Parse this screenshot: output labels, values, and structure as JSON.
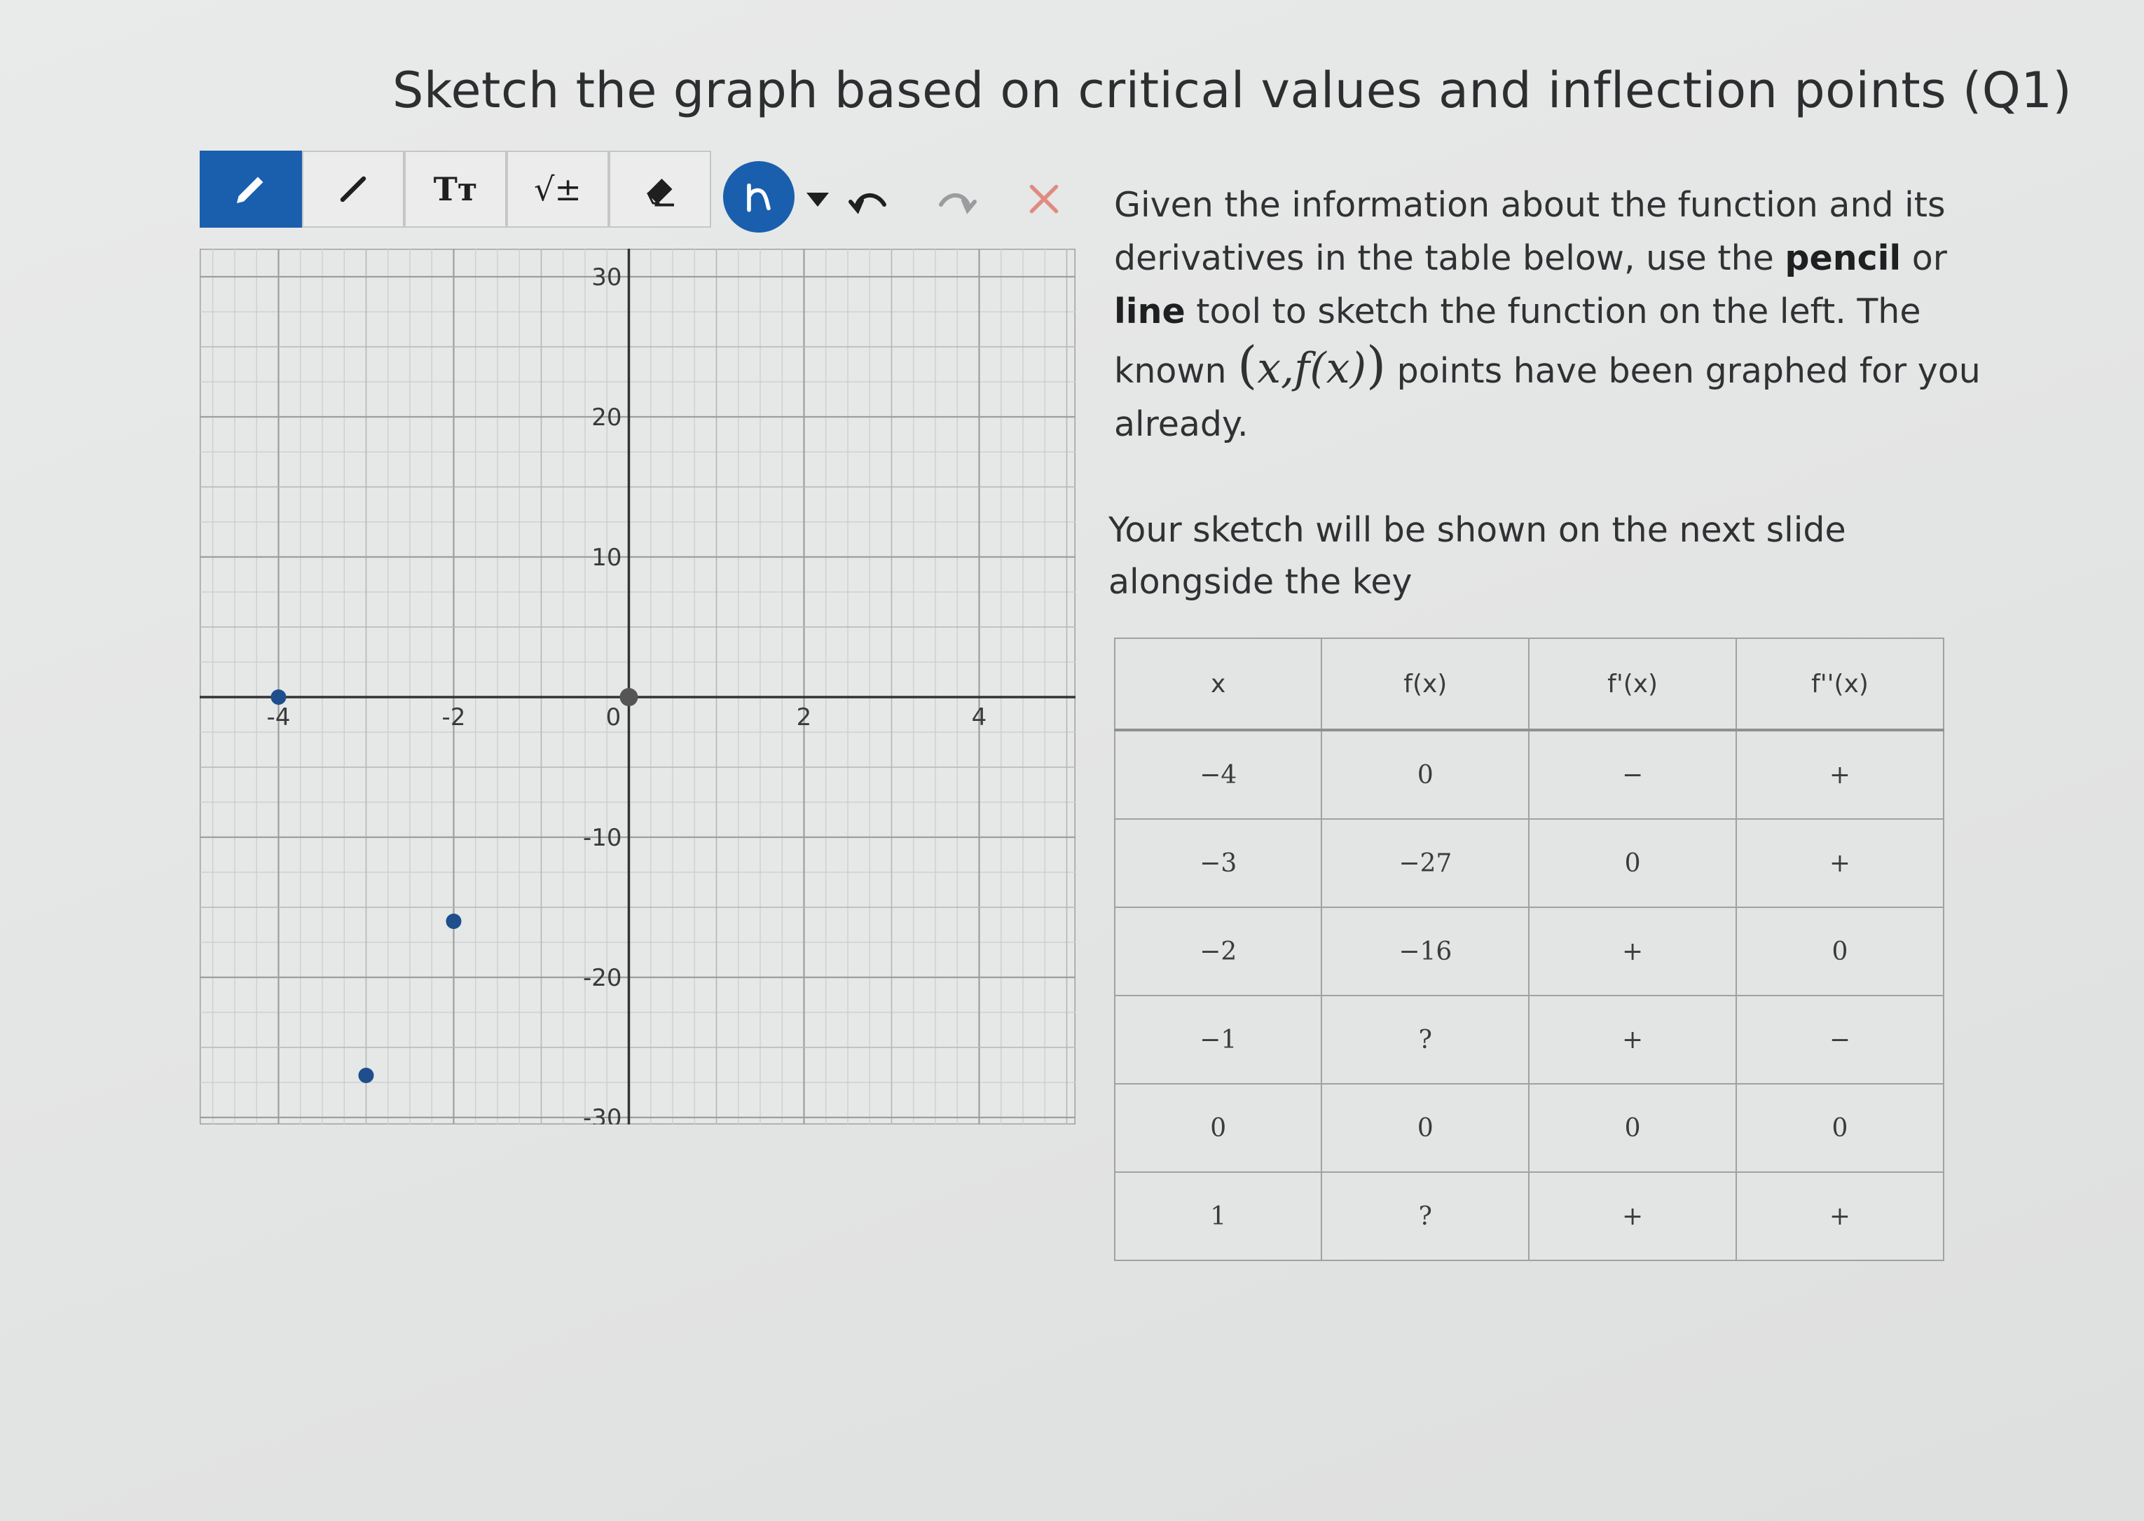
{
  "page": {
    "title": "Sketch the graph based on critical values and inflection points (Q1)"
  },
  "toolbar": {
    "pencil_icon": "pencil-icon",
    "line_icon": "line-icon",
    "text_label": "Tт",
    "math_label": "√±",
    "eraser_icon": "eraser-icon",
    "lasso_icon": "lasso-icon",
    "dropdown_icon": "caret-down-icon",
    "undo_icon": "undo-icon",
    "redo_icon": "redo-icon",
    "clear_icon": "close-icon",
    "active_color": "#1a5fae"
  },
  "instructions": {
    "line1": "Given the information about the function and its derivatives in the table below, use the ",
    "pencil": "pencil",
    "or": " or ",
    "line": "line",
    "line2": " tool to sketch the function on the left.  The known ",
    "math": "x,f(x)",
    "line3": " points have been graphed for you already.",
    "note": "Your sketch will be shown on the next slide alongside the key"
  },
  "chart_data": {
    "type": "scatter",
    "x_ticks": [
      "-4",
      "-2",
      "0",
      "2",
      "4"
    ],
    "y_ticks": [
      "30",
      "20",
      "10",
      "-10",
      "-20",
      "-30"
    ],
    "xlim": [
      -4.9,
      5.1
    ],
    "ylim": [
      -30.5,
      32
    ],
    "grid": true,
    "points": [
      {
        "x": -4,
        "y": 0
      },
      {
        "x": -3,
        "y": -27
      },
      {
        "x": -2,
        "y": -16
      },
      {
        "x": 0,
        "y": 0
      }
    ],
    "point_color": "#1f4e8c",
    "origin_point_color": "#555555"
  },
  "table": {
    "headers": [
      "x",
      "f(x)",
      "f'(x)",
      "f''(x)"
    ],
    "rows": [
      [
        "−4",
        "0",
        "−",
        "+"
      ],
      [
        "−3",
        "−27",
        "0",
        "+"
      ],
      [
        "−2",
        "−16",
        "+",
        "0"
      ],
      [
        "−1",
        "?",
        "+",
        "−"
      ],
      [
        "0",
        "0",
        "0",
        "0"
      ],
      [
        "1",
        "?",
        "+",
        "+"
      ]
    ]
  }
}
